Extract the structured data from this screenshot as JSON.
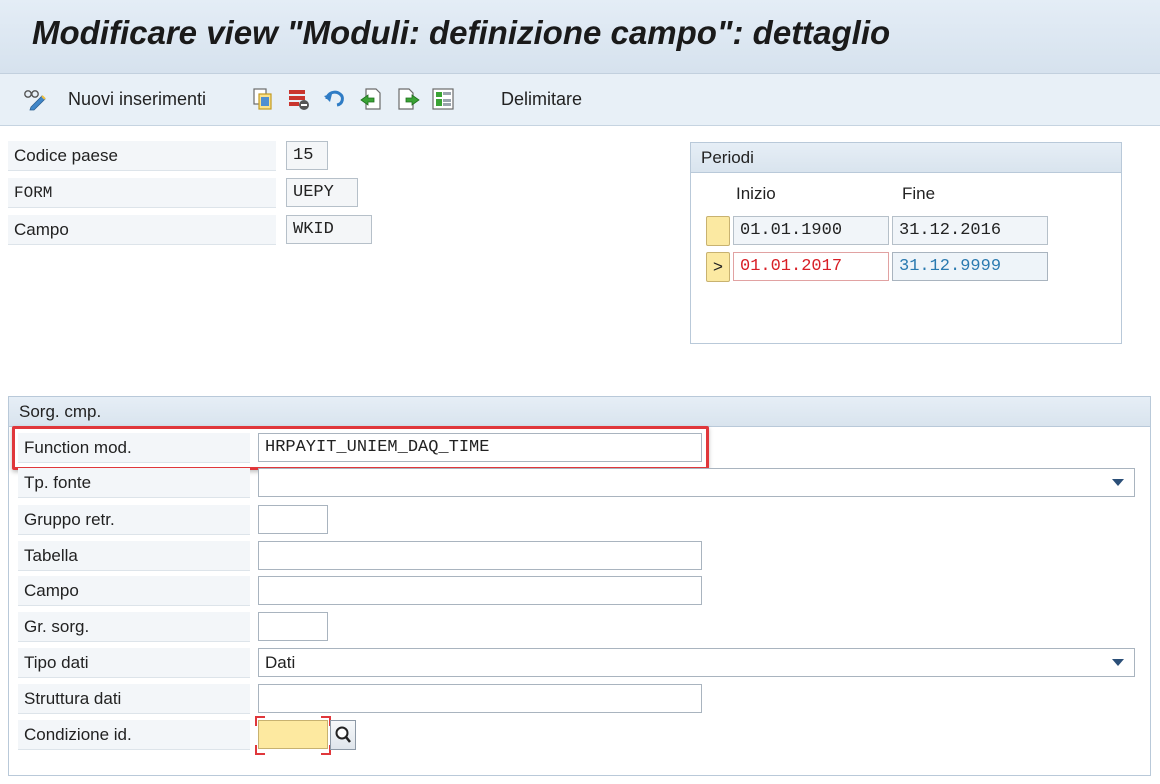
{
  "window": {
    "title": "Modificare view \"Moduli: definizione campo\": dettaglio"
  },
  "toolbar": {
    "new_entries_label": "Nuovi inserimenti",
    "delimit_label": "Delimitare"
  },
  "header_fields": {
    "codice_paese": {
      "label": "Codice paese",
      "value": "15"
    },
    "form": {
      "label": "FORM",
      "value": "UEPY"
    },
    "campo": {
      "label": "Campo",
      "value": "WKID"
    }
  },
  "periods": {
    "title": "Periodi",
    "col_start": "Inizio",
    "col_end": "Fine",
    "rows": [
      {
        "marker": "",
        "start": "01.01.1900",
        "end": "31.12.2016"
      },
      {
        "marker": ">",
        "start": "01.01.2017",
        "end": "31.12.9999"
      }
    ],
    "colors": {
      "current_start": "#d81f26",
      "current_end": "#2a7ab0"
    }
  },
  "source": {
    "title": "Sorg. cmp.",
    "function_mod": {
      "label": "Function mod.",
      "value": "HRPAYIT_UNIEM_DAQ_TIME"
    },
    "tp_fonte": {
      "label": "Tp. fonte",
      "value": ""
    },
    "gruppo_retr": {
      "label": "Gruppo retr.",
      "value": ""
    },
    "tabella": {
      "label": "Tabella",
      "value": ""
    },
    "campo": {
      "label": "Campo",
      "value": ""
    },
    "gr_sorg": {
      "label": "Gr. sorg.",
      "value": ""
    },
    "tipo_dati": {
      "label": "Tipo dati",
      "value": "Dati"
    },
    "struttura_dati": {
      "label": "Struttura dati",
      "value": ""
    },
    "condizione_id": {
      "label": "Condizione id.",
      "value": ""
    }
  },
  "icons": {
    "new_entries": "glasses-pencil-icon",
    "copy": "copy-icon",
    "delete": "delete-rows-icon",
    "undo": "undo-icon",
    "prev": "previous-entry-icon",
    "next": "next-entry-icon",
    "select": "select-block-icon",
    "search": "search-icon"
  },
  "accent_colors": {
    "highlight": "#e0373b",
    "required_field": "#fde9a0"
  }
}
